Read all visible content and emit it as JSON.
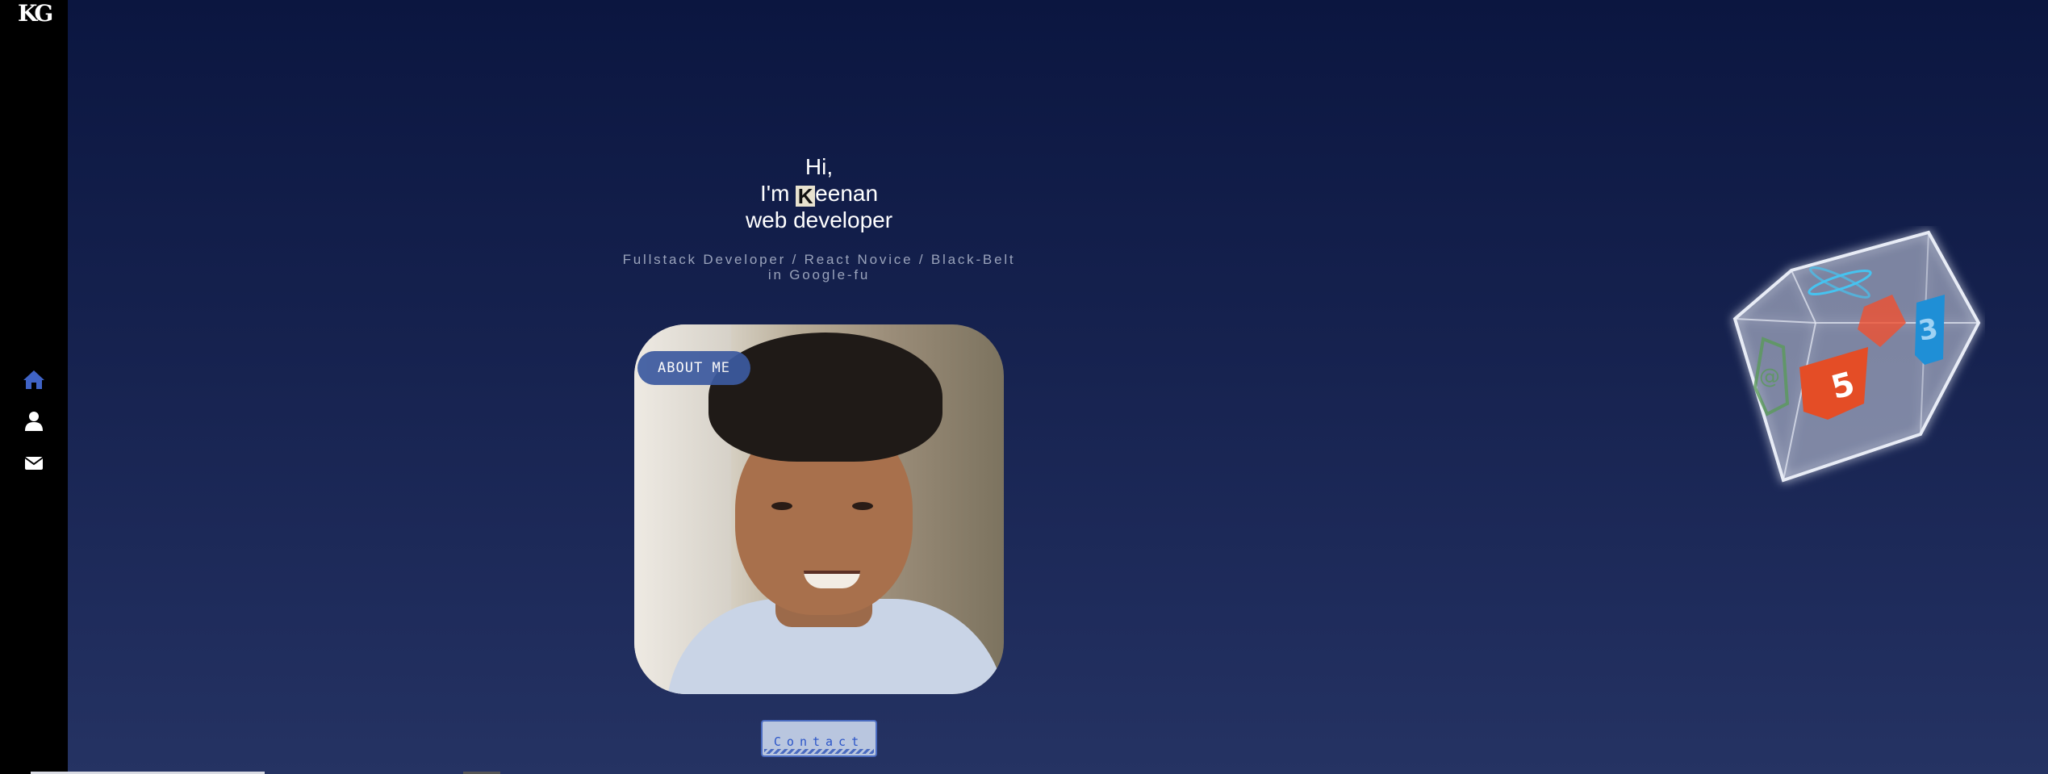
{
  "sidebar": {
    "logo": "KG",
    "nav": [
      {
        "icon": "home-icon",
        "color": "#3f63c6"
      },
      {
        "icon": "user-icon",
        "color": "#ffffff"
      },
      {
        "icon": "envelope-icon",
        "color": "#ffffff"
      }
    ]
  },
  "hero": {
    "line1": "Hi,",
    "line2_prefix": "I'm ",
    "line2_k": "K",
    "line2_rest": "eenan",
    "line3": "web developer",
    "subtitle": "Fullstack Developer / React Novice / Black-Belt in Google-fu"
  },
  "about_label": "ABOUT ME",
  "contact_label": "Contact",
  "cube_faces": [
    "css3-icon",
    "html5-icon",
    "git-icon",
    "nodejs-icon",
    "react-icon"
  ],
  "colors": {
    "accent": "#3f63c6",
    "html5": "#e44d26",
    "css3": "#1f8fd6",
    "node": "#5a9a5a"
  }
}
